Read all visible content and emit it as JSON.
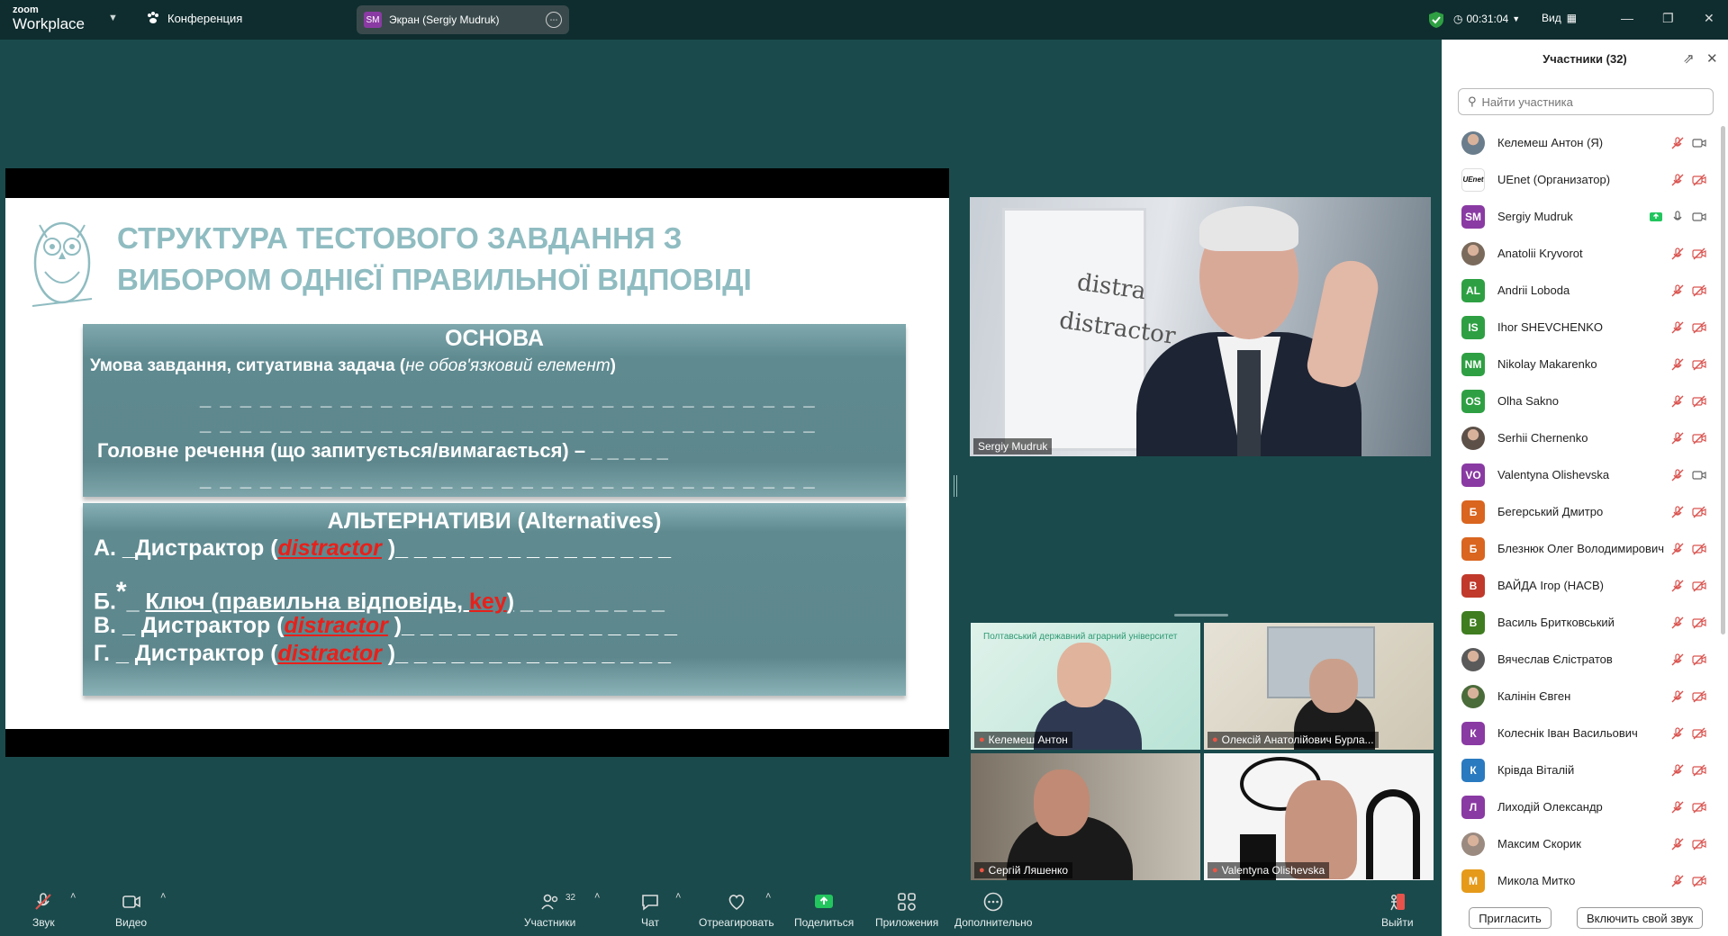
{
  "app": {
    "brand_top": "zoom",
    "brand_bottom": "Workplace"
  },
  "meeting_label": "Конференция",
  "share_tab": {
    "badge": "SM",
    "label": "Экран (Sergiy Mudruk)"
  },
  "timer": "00:31:04",
  "view_label": "Вид",
  "slide": {
    "title_line1": "СТРУКТУРА ТЕСТОВОГО ЗАВДАННЯ З",
    "title_line2": "ВИБОРОМ ОДНІЄЇ ПРАВИЛЬНОЇ ВІДПОВІДІ",
    "box1_head": "ОСНОВА",
    "box1_line1_bold": "Умова завдання, ситуативна задача (",
    "box1_line1_italic": "не обов'язковий елемент",
    "box1_line1_end": ")",
    "box1_dashes1": "_ _ _ _ _ _ _ _ _ _ _ _ _ _ _ _ _ _ _ _ _ _ _ _ _ _ _ _ _ _ _",
    "box1_dashes2": "_ _ _ _ _ _ _ _ _ _ _ _ _ _ _ _ _ _ _ _ _ _ _ _ _ _ _ _ _ _ _",
    "box1_main": "Головне речення (що запитується/вимагається) – _ _ _ _ _",
    "box1_dashes3": "_ _ _ _ _ _ _ _ _ _ _ _ _ _ _ _ _ _ _ _ _ _ _ _ _ _ _ _ _ _ _",
    "box2_head": "АЛЬТЕРНАТИВИ (Alternatives)",
    "alt_a_pre": "А. _Дистрактор (",
    "alt_a_red": "distractor",
    "alt_a_post": " )_ _ _ _ _ _ _ _ _ _ _ _ _ _ _",
    "alt_b_pre": "Б.",
    "alt_b_star": "*",
    "alt_b_mid": "_ ",
    "alt_b_key_text": "Ключ (правильна відповідь, ",
    "alt_b_key": "key",
    "alt_b_close": ")",
    "alt_b_post": " _ _ _ _ _ _ _ _",
    "alt_c_pre": "В. _ Дистрактор (",
    "alt_c_red": "distractor",
    "alt_c_post": " )_ _ _ _ _ _ _ _ _ _ _ _ _ _ _",
    "alt_d_pre": "Г. _ Дистрактор (",
    "alt_d_red": "distractor",
    "alt_d_post": " )_ _ _ _ _ _ _ _ _ _ _ _ _ _ _"
  },
  "speaker": {
    "name": "Sergiy Mudruk",
    "board_text1": "distra",
    "board_text2": "distractor"
  },
  "tiles": [
    {
      "name": "Келемеш Антон",
      "banner": "Полтавський державний аграрний університет"
    },
    {
      "name": "Олексій Анатолійович Бурла..."
    },
    {
      "name": "Сергій Ляшенко"
    },
    {
      "name": "Valentyna Olishevska"
    }
  ],
  "panel": {
    "title": "Участники (32)",
    "search_placeholder": "Найти участника",
    "invite": "Пригласить",
    "unmute_self": "Включить свой звук"
  },
  "participants": [
    {
      "name": "Келемеш Антон (Я)",
      "initials": "",
      "color": "#6a7d8c",
      "photo": true,
      "mic": "muted",
      "cam": "on"
    },
    {
      "name": "UEnet (Организатор)",
      "initials": "UEnet",
      "color": "#ffffff",
      "photo": false,
      "logo": true,
      "mic": "muted",
      "cam": "off"
    },
    {
      "name": "Sergiy Mudruk",
      "initials": "SM",
      "color": "#8a3aa3",
      "photo": false,
      "mic": "on",
      "cam": "on",
      "sharing": true
    },
    {
      "name": "Anatolii Kryvorot",
      "initials": "",
      "color": "#7a6a5c",
      "photo": true,
      "mic": "muted",
      "cam": "off"
    },
    {
      "name": "Andrii Loboda",
      "initials": "AL",
      "color": "#2ea043",
      "photo": false,
      "mic": "muted",
      "cam": "off"
    },
    {
      "name": "Ihor SHEVCHENKO",
      "initials": "IS",
      "color": "#2ea043",
      "photo": false,
      "mic": "muted",
      "cam": "off"
    },
    {
      "name": "Nikolay Makarenko",
      "initials": "NM",
      "color": "#2ea043",
      "photo": false,
      "mic": "muted",
      "cam": "off"
    },
    {
      "name": "Olha Sakno",
      "initials": "OS",
      "color": "#2ea043",
      "photo": false,
      "mic": "muted",
      "cam": "off"
    },
    {
      "name": "Serhii Chernenko",
      "initials": "",
      "color": "#5c5048",
      "photo": true,
      "mic": "muted",
      "cam": "off"
    },
    {
      "name": "Valentyna Olishevska",
      "initials": "VO",
      "color": "#8a3aa3",
      "photo": false,
      "mic": "muted",
      "cam": "on"
    },
    {
      "name": "Бегерський Дмитро",
      "initials": "Б",
      "color": "#d9651f",
      "photo": false,
      "mic": "muted",
      "cam": "off"
    },
    {
      "name": "Блезнюк Олег Володимирович",
      "initials": "Б",
      "color": "#d9651f",
      "photo": false,
      "mic": "muted",
      "cam": "off"
    },
    {
      "name": "ВАЙДА Ігор (НАСВ)",
      "initials": "В",
      "color": "#c0392b",
      "photo": false,
      "mic": "muted",
      "cam": "off"
    },
    {
      "name": "Василь Бритковський",
      "initials": "В",
      "color": "#3f7d20",
      "photo": false,
      "mic": "muted",
      "cam": "off"
    },
    {
      "name": "Вячеслав Єлістратов",
      "initials": "",
      "color": "#5a5a5a",
      "photo": true,
      "mic": "muted",
      "cam": "off"
    },
    {
      "name": "Калінін Євген",
      "initials": "",
      "color": "#4a6b3a",
      "photo": true,
      "mic": "muted",
      "cam": "off"
    },
    {
      "name": "Колеснік Іван Васильович",
      "initials": "К",
      "color": "#8a3aa3",
      "photo": false,
      "mic": "muted",
      "cam": "off"
    },
    {
      "name": "Крівда Віталій",
      "initials": "К",
      "color": "#2a7ac0",
      "photo": false,
      "mic": "muted",
      "cam": "off"
    },
    {
      "name": "Лиходій Олександр",
      "initials": "Л",
      "color": "#8a3aa3",
      "photo": false,
      "mic": "muted",
      "cam": "off"
    },
    {
      "name": "Максим Скорик",
      "initials": "",
      "color": "#9a8a80",
      "photo": true,
      "mic": "muted",
      "cam": "off"
    },
    {
      "name": "Микола Митко",
      "initials": "М",
      "color": "#e59a1a",
      "photo": false,
      "mic": "muted",
      "cam": "off"
    }
  ],
  "toolbar": {
    "audio": "Звук",
    "video": "Видео",
    "participants": "Участники",
    "participants_count": "32",
    "chat": "Чат",
    "react": "Отреагировать",
    "share": "Поделиться",
    "apps": "Приложения",
    "more": "Дополнительно",
    "leave": "Выйти"
  }
}
